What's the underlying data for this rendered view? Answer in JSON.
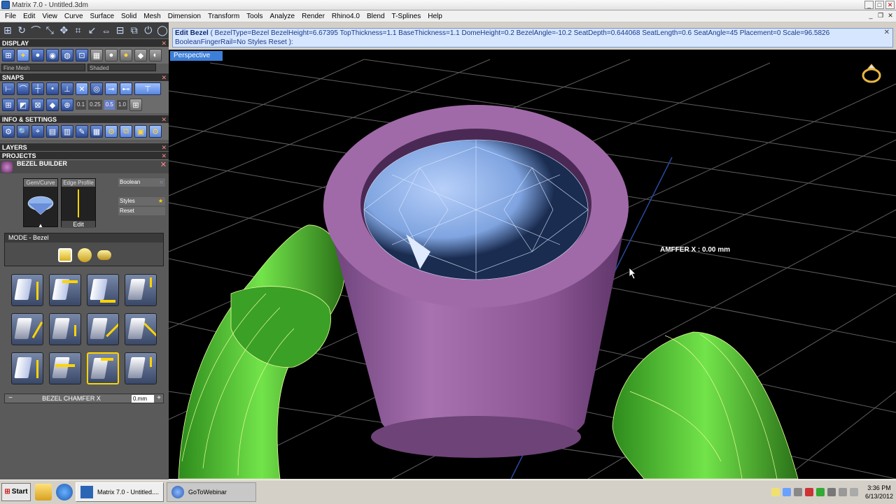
{
  "window": {
    "title": "Matrix 7.0 - Untitled.3dm"
  },
  "menu": [
    "File",
    "Edit",
    "View",
    "Curve",
    "Surface",
    "Solid",
    "Mesh",
    "Dimension",
    "Transform",
    "Tools",
    "Analyze",
    "Render",
    "Rhino4.0",
    "Blend",
    "T-Splines",
    "Help"
  ],
  "panel": {
    "display_title": "DISPLAY",
    "display_mesh": "Fine Mesh",
    "display_shade": "Shaded",
    "snaps_title": "SNAPS",
    "snap_values": [
      "0.1",
      "0.25",
      "0.5",
      "1.0"
    ],
    "info_title": "INFO & SETTINGS",
    "layers_title": "LAYERS",
    "projects_title": "PROJECTS",
    "bezel_title": "BEZEL BUILDER",
    "gem_curve_label": "Gem/Curve",
    "edge_profile_label": "Edge Profile",
    "edit_label": "Edit",
    "boolean_label": "Boolean",
    "styles_label": "Styles",
    "reset_label": "Reset",
    "mode_label": "MODE - Bezel",
    "chamfer_label": "BEZEL CHAMFER X",
    "chamfer_value": "0.mm"
  },
  "command": {
    "name": "Edit Bezel",
    "line1": "( BezelType=Bezel  BezelHeight=6.67395  TopThickness=1.1  BaseThickness=1.1  DomeHeight=0.2  BezelAngle=-10.2  SeatDepth=0.644068  SeatLength=0.6  SeatAngle=45  Placement=0  Scale=96.5826",
    "line2": "BooleanFingerRail=No  Styles  Reset ):"
  },
  "viewport": {
    "title": "Perspective",
    "overlay": "AMFFER X : 0.00 mm",
    "colors": {
      "bezel": "#9a62a2",
      "ring": "#5edc3c",
      "gem": "#8fb3ec",
      "grid": "#6a6a6a"
    }
  },
  "taskbar": {
    "start": "Start",
    "task_matrix": "Matrix 7.0 - Untitled....",
    "task_goto": "GoToWebinar",
    "time": "3:36 PM",
    "date": "6/13/2012"
  }
}
